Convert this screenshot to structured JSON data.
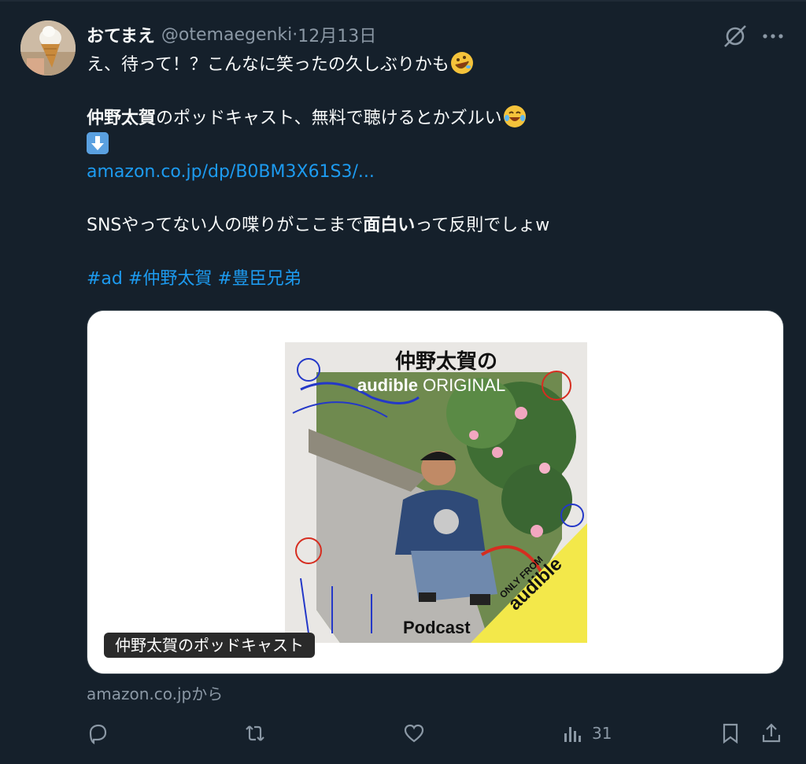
{
  "tweet": {
    "display_name": "おてまえ",
    "handle": "@otemaegenki",
    "separator": " · ",
    "date": "12月13日",
    "lines": {
      "line1": "え、待って！？こんなに笑ったの久しぶりかも",
      "line2_bold": "仲野太賀",
      "line2_rest": "のポッドキャスト、無料で聴けるとかズルい",
      "link": "amazon.co.jp/dp/B0BM3X61S3/...",
      "line4_pre": "SNSやってない人の喋りがここまで",
      "line4_bold": "面白い",
      "line4_post": "って反則でしょw"
    },
    "hashtags": [
      "#ad",
      "#仲野太賀",
      "#豊臣兄弟"
    ],
    "emojis": [
      "rolling-on-floor-laughing-emoji",
      "tears-of-joy-emoji",
      "down-arrow-emoji"
    ]
  },
  "card": {
    "label": "仲野太賀のポッドキャスト",
    "art_title": "仲野太賀の",
    "art_brand": "audible",
    "art_brand_suffix": "ORIGINAL",
    "art_podcast": "Podcast",
    "art_badge_top": "ONLY FROM",
    "art_badge_brand": "audible",
    "source": "amazon.co.jpから"
  },
  "actions": {
    "reply_icon": "reply-icon",
    "retweet_icon": "retweet-icon",
    "like_icon": "heart-icon",
    "views_icon": "views-chart-icon",
    "views_count": "31",
    "bookmark_icon": "bookmark-icon",
    "share_icon": "share-icon"
  },
  "colors": {
    "background": "#15202b",
    "link": "#1d9bf0",
    "muted": "#8b98a5",
    "badge_yellow": "#f3e84a"
  }
}
